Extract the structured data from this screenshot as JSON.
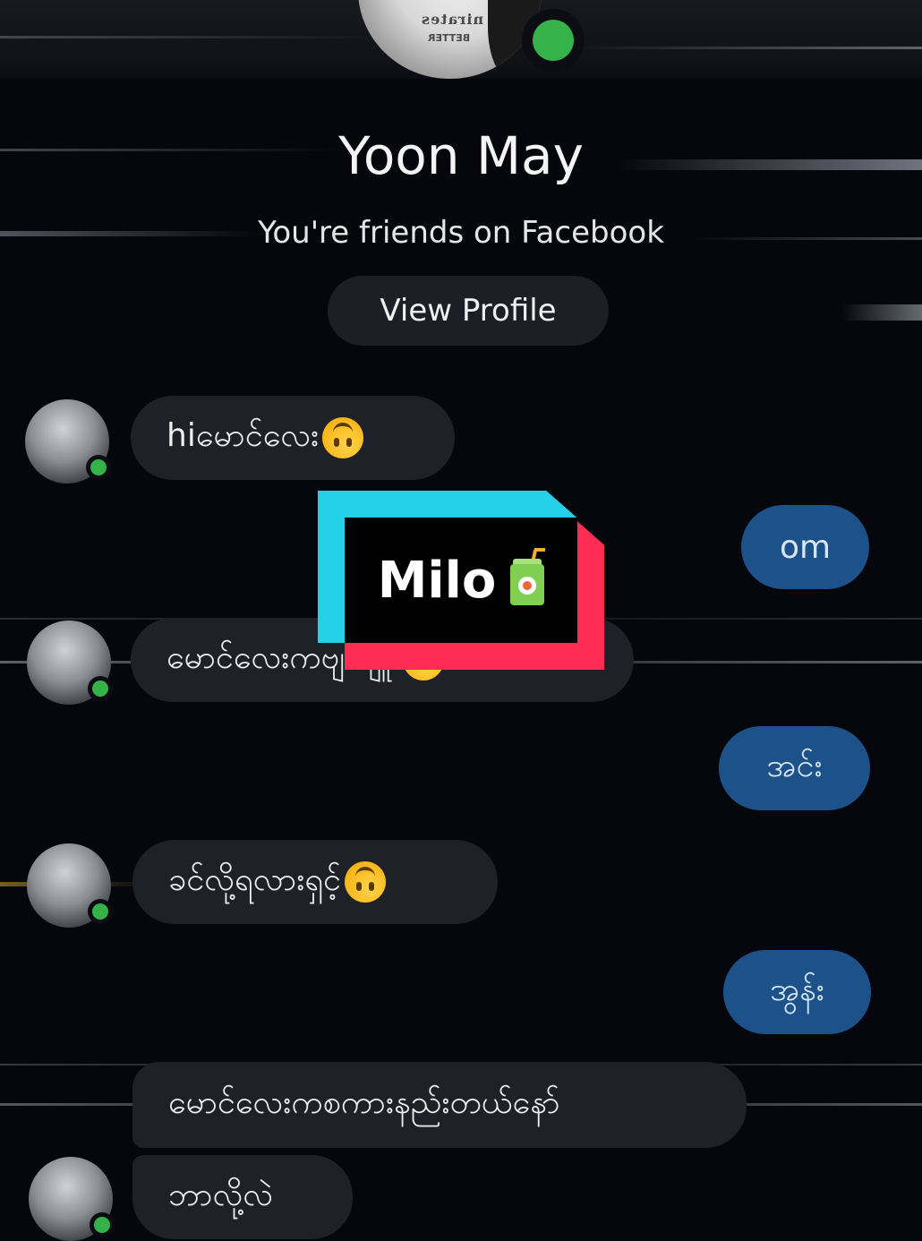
{
  "contact": {
    "name": "Yoon May",
    "relationship": "You're friends on Facebook",
    "view_profile_label": "View Profile"
  },
  "avatar_shirt_text": "nirates",
  "avatar_shirt_text2": "BETTER",
  "overlay": {
    "sticker_text": "Milo",
    "sticker_icon": "juice-box-icon",
    "colors": {
      "cyan": "#25d0e8",
      "red": "#fe2c55",
      "fill": "#000000"
    }
  },
  "messages": [
    {
      "from": "them",
      "text": "hiမောင်လေး",
      "emoji": "upside-down-face"
    },
    {
      "from": "me",
      "text": "om"
    },
    {
      "from": "them",
      "text": "မောင်လေးကဗျ    ျူး",
      "emoji": "upside-down-face"
    },
    {
      "from": "me",
      "text": "အင်း"
    },
    {
      "from": "them",
      "text": "ခင်လို့ရလားရှင့်",
      "emoji": "upside-down-face"
    },
    {
      "from": "me",
      "text": "အွန်း"
    },
    {
      "from": "them",
      "text": "မောင်လေးကစကားနည်းတယ်နော်"
    },
    {
      "from": "them",
      "text": "ဘာလို့လဲ"
    }
  ],
  "colors": {
    "background": "#05070d",
    "incoming_bubble": "#1e2127",
    "outgoing_bubble": "#1c5189",
    "online": "#36b24a"
  }
}
